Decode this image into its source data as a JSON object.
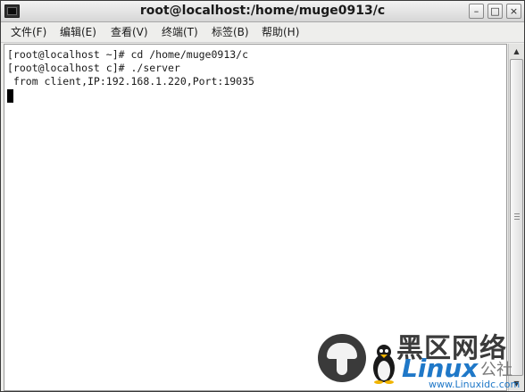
{
  "window": {
    "title": "root@localhost:/home/muge0913/c",
    "buttons": {
      "minimize": "–",
      "maximize": "□",
      "close": "×"
    }
  },
  "menu": [
    {
      "id": "file",
      "label": "文件(F)"
    },
    {
      "id": "edit",
      "label": "编辑(E)"
    },
    {
      "id": "view",
      "label": "查看(V)"
    },
    {
      "id": "terminal",
      "label": "终端(T)"
    },
    {
      "id": "tabs",
      "label": "标签(B)"
    },
    {
      "id": "help",
      "label": "帮助(H)"
    }
  ],
  "terminal": {
    "lines": [
      "[root@localhost ~]# cd /home/muge0913/c",
      "[root@localhost c]# ./server",
      " from client,IP:192.168.1.220,Port:19035"
    ]
  },
  "scrollbar": {
    "up": "▲",
    "down": "▼"
  },
  "watermark": {
    "cn_text": "黑区网络",
    "linux": "Linux",
    "gongshe": "公社",
    "url": "www.Linuxidc.com"
  }
}
